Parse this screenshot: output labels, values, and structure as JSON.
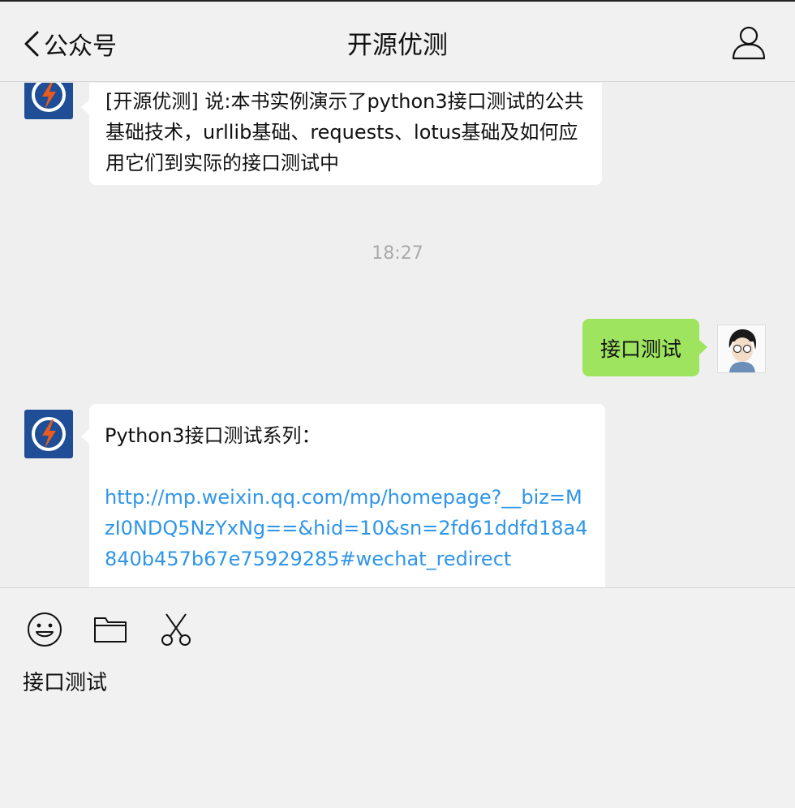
{
  "header": {
    "back_label": "公众号",
    "title": "开源优测"
  },
  "messages": {
    "first_text": "[开源优测] 说:本书实例演示了python3接口测试的公共基础技术，urllib基础、requests、lotus基础及如何应用它们到实际的接口测试中",
    "time": "18:27",
    "user_text": "接口测试",
    "second_title": "Python3接口测试系列：",
    "second_link": "http://mp.weixin.qq.com/mp/homepage?__biz=MzI0NDQ5NzYxNg==&hid=10&sn=2fd61ddfd18a4840b457b67e75929285#wechat_redirect"
  },
  "input": {
    "text": "接口测试"
  },
  "icons": {
    "back": "chevron-left-icon",
    "profile": "person-icon",
    "emoji": "smiley-icon",
    "folder": "folder-icon",
    "scissors": "scissors-icon"
  },
  "colors": {
    "link": "#2f95e8",
    "user_bubble": "#9ee45f",
    "logo_bg": "#1f4e96"
  }
}
